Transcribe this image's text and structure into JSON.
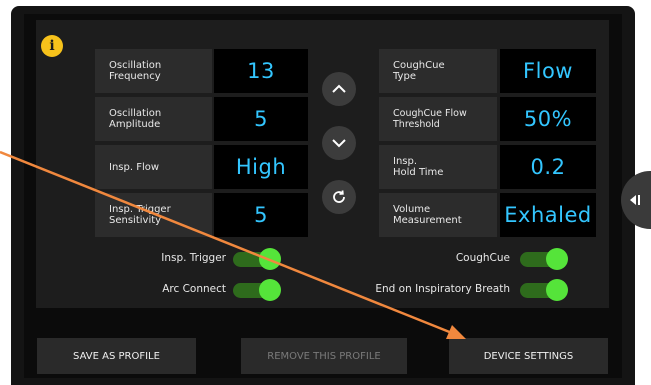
{
  "left_params": [
    {
      "label": "Oscillation\nFrequency",
      "value": "13"
    },
    {
      "label": "Oscillation\nAmplitude",
      "value": "5"
    },
    {
      "label": "Insp. Flow",
      "value": "High"
    },
    {
      "label": "Insp. Trigger\nSensitivity",
      "value": "5"
    }
  ],
  "right_params": [
    {
      "label": "CoughCue\nType",
      "value": "Flow"
    },
    {
      "label": "CoughCue Flow\nThreshold",
      "value": "50%"
    },
    {
      "label": "Insp.\nHold Time",
      "value": "0.2"
    },
    {
      "label": "Volume\nMeasurement",
      "value": "Exhaled"
    }
  ],
  "toggles": {
    "insp_trigger": {
      "label": "Insp. Trigger",
      "state": "on"
    },
    "arc_connect": {
      "label": "Arc Connect",
      "state": "on"
    },
    "coughcue": {
      "label": "CoughCue",
      "state": "on"
    },
    "end_on_insp": {
      "label": "End on Inspiratory Breath",
      "state": "on"
    }
  },
  "buttons": {
    "save_profile": "SAVE AS PROFILE",
    "remove_profile": "REMOVE THIS PROFILE",
    "device_settings": "DEVICE SETTINGS"
  },
  "controls": {
    "up": "chevron-up-icon",
    "down": "chevron-down-icon",
    "reset": "reset-icon"
  },
  "colors": {
    "value_text": "#33c6ff",
    "toggle_on": "#55e43a",
    "info": "#f7c21b",
    "annotation_arrow": "#f0883e"
  }
}
